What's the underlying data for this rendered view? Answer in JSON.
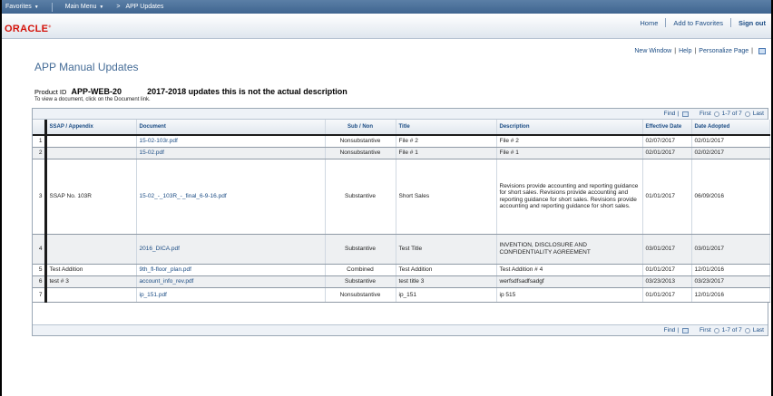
{
  "nav": {
    "favorites": "Favorites",
    "main_menu": "Main Menu",
    "separator": ">",
    "breadcrumb": "APP Updates"
  },
  "header": {
    "logo": "ORACLE",
    "home": "Home",
    "add_to_favorites": "Add to Favorites",
    "sign_out": "Sign out"
  },
  "page_links": {
    "new_window": "New Window",
    "help": "Help",
    "personalize": "Personalize Page",
    "sep": "|"
  },
  "page": {
    "title": "APP Manual Updates",
    "product_label": "Product ID",
    "product_id": "APP-WEB-20",
    "product_desc": "2017-2018 updates  this is not the actual description",
    "instructions": "To view a document, click on the Document link."
  },
  "grid": {
    "find": "Find",
    "first": "First",
    "count": "1-7 of 7",
    "last": "Last",
    "pipe": "|",
    "columns": {
      "ssap": "SSAP / Appendix",
      "document": "Document",
      "sub_non": "Sub / Non",
      "title": "Title",
      "description": "Description",
      "effective_date": "Effective Date",
      "date_adopted": "Date Adopted"
    },
    "rows": [
      {
        "num": "1",
        "ssap": "",
        "document": "15-02-103r.pdf",
        "sub_non": "Nonsubstantive",
        "title": "File # 2",
        "description": "File # 2",
        "effective_date": "02/07/2017",
        "date_adopted": "02/01/2017"
      },
      {
        "num": "2",
        "ssap": "",
        "document": "15-02.pdf",
        "sub_non": "Nonsubstantive",
        "title": "File # 1",
        "description": "File # 1",
        "effective_date": "02/01/2017",
        "date_adopted": "02/02/2017"
      },
      {
        "num": "3",
        "ssap": "SSAP No. 103R",
        "document": "15-02_-_103R_-_final_6-9-16.pdf",
        "sub_non": "Substantive",
        "title": "Short Sales",
        "description": "Revisions provide accounting and reporting guidance for short sales. Revisions provide accounting and reporting guidance for short sales. Revisions provide accounting and reporting guidance for short sales.",
        "effective_date": "01/01/2017",
        "date_adopted": "06/09/2016"
      },
      {
        "num": "4",
        "ssap": "",
        "document": "2016_DICA.pdf",
        "sub_non": "Substantive",
        "title": "Test Title",
        "description": "INVENTION, DISCLOSURE AND CONFIDENTIALITY AGREEMENT",
        "effective_date": "03/01/2017",
        "date_adopted": "03/01/2017"
      },
      {
        "num": "5",
        "ssap": "Test Addition",
        "document": "9th_fl-floor_plan.pdf",
        "sub_non": "Combined",
        "title": "Test Addition",
        "description": "Test Addition # 4",
        "effective_date": "01/01/2017",
        "date_adopted": "12/01/2016"
      },
      {
        "num": "6",
        "ssap": "test # 3",
        "document": "account_info_rev.pdf",
        "sub_non": "Substantive",
        "title": "test title 3",
        "description": "werfsdfsadfsadgf",
        "effective_date": "03/23/2013",
        "date_adopted": "03/23/2017"
      },
      {
        "num": "7",
        "ssap": "",
        "document": "ip_151.pdf",
        "sub_non": "Nonsubstantive",
        "title": "ip_151",
        "description": "ip 515",
        "effective_date": "01/01/2017",
        "date_adopted": "12/01/2016"
      }
    ]
  }
}
